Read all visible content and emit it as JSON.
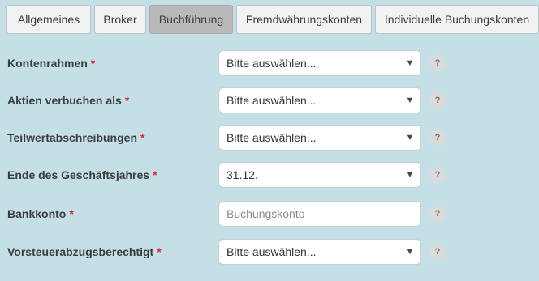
{
  "tabs": [
    {
      "label": "Allgemeines",
      "active": false
    },
    {
      "label": "Broker",
      "active": false
    },
    {
      "label": "Buchführung",
      "active": true
    },
    {
      "label": "Fremdwährungskonten",
      "active": false
    },
    {
      "label": "Individuelle Buchungskonten",
      "active": false
    }
  ],
  "required_marker": "*",
  "help_icon_text": "?",
  "fields": [
    {
      "label": "Kontenrahmen",
      "type": "select",
      "value": "Bitte auswählen...",
      "required": true
    },
    {
      "label": "Aktien verbuchen als",
      "type": "select",
      "value": "Bitte auswählen...",
      "required": true
    },
    {
      "label": "Teilwertabschreibungen",
      "type": "select",
      "value": "Bitte auswählen...",
      "required": true
    },
    {
      "label": "Ende des Geschäftsjahres",
      "type": "select",
      "value": "31.12.",
      "required": true
    },
    {
      "label": "Bankkonto",
      "type": "input",
      "value": "",
      "placeholder": "Buchungskonto",
      "required": true
    },
    {
      "label": "Vorsteuerabzugsberechtigt",
      "type": "select",
      "value": "Bitte auswählen...",
      "required": true
    }
  ],
  "colors": {
    "background": "#c4dfe6",
    "tab_active": "#b9b9b9",
    "tab_inactive": "#f2f2f2",
    "required": "#d9262f"
  }
}
